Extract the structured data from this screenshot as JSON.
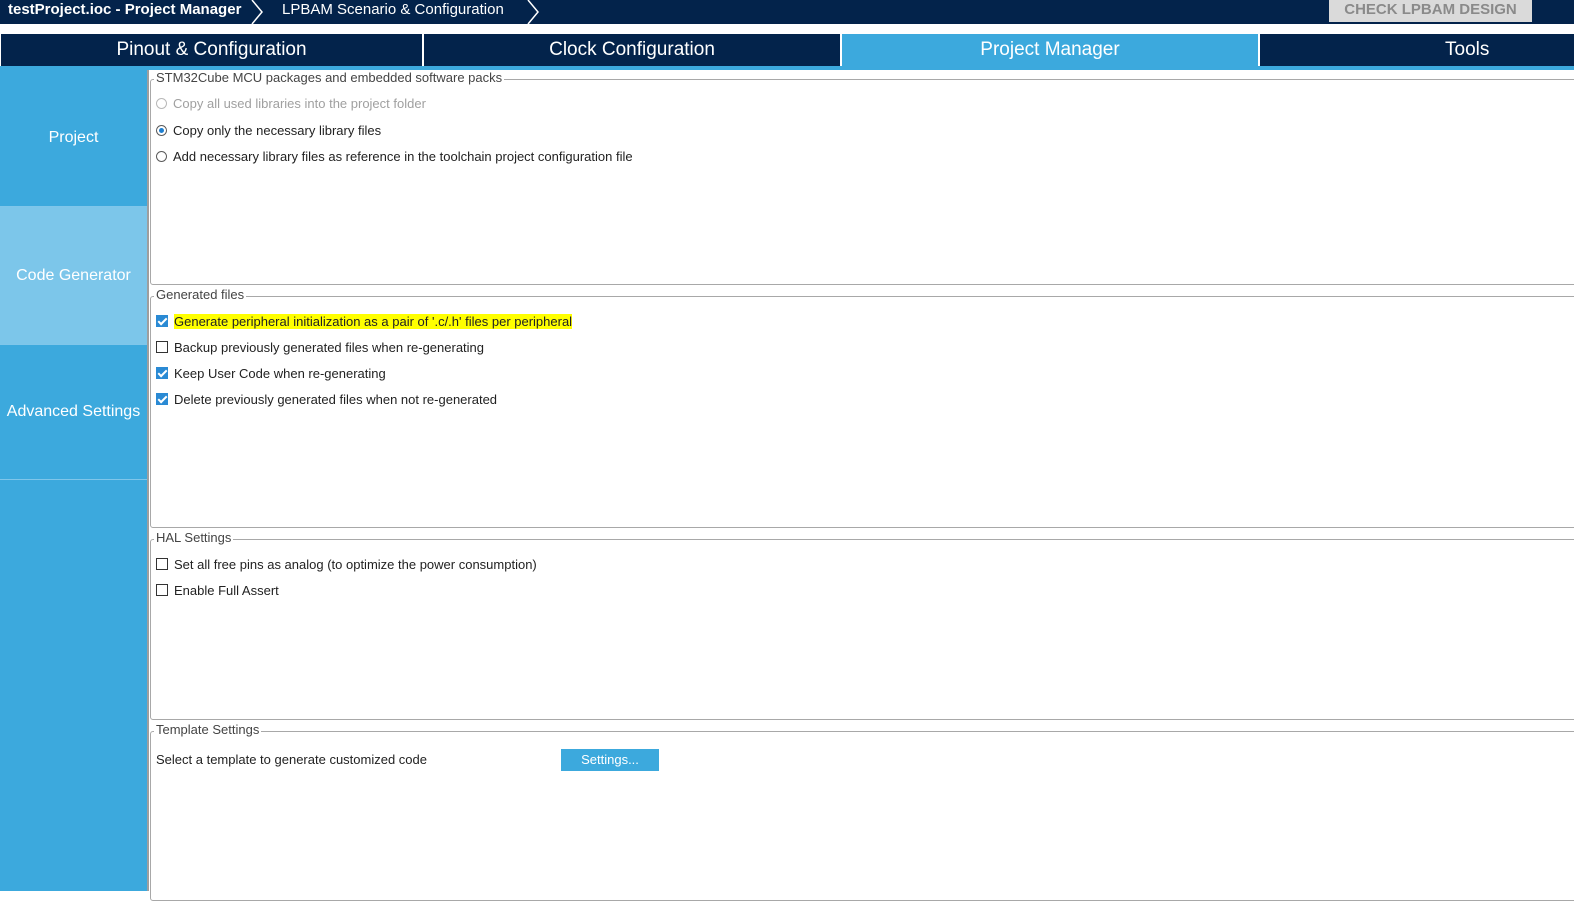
{
  "breadcrumb": {
    "items": [
      "testProject.ioc - Project Manager",
      "LPBAM Scenario & Configuration"
    ]
  },
  "top_button": "CHECK LPBAM DESIGN",
  "tabs": [
    {
      "label": "Pinout & Configuration",
      "active": false
    },
    {
      "label": "Clock Configuration",
      "active": false
    },
    {
      "label": "Project Manager",
      "active": true
    },
    {
      "label": "Tools",
      "active": false
    }
  ],
  "sidebar": {
    "items": [
      {
        "label": "Project",
        "active": false
      },
      {
        "label": "Code Generator",
        "active": true
      },
      {
        "label": "Advanced Settings",
        "active": false
      }
    ]
  },
  "packs_group": {
    "title": "STM32Cube MCU packages and embedded software packs",
    "options": [
      {
        "label": "Copy all used libraries into the project folder",
        "selected": false,
        "enabled": false
      },
      {
        "label": "Copy only the necessary library files",
        "selected": true,
        "enabled": true
      },
      {
        "label": "Add necessary library files as reference in the toolchain project configuration file",
        "selected": false,
        "enabled": true
      }
    ]
  },
  "generated_group": {
    "title": "Generated files",
    "options": [
      {
        "label": "Generate peripheral initialization as a pair of '.c/.h' files per peripheral",
        "checked": true,
        "highlighted": true
      },
      {
        "label": "Backup previously generated files when re-generating",
        "checked": false
      },
      {
        "label": "Keep User Code when re-generating",
        "checked": true
      },
      {
        "label": "Delete previously generated files when not re-generated",
        "checked": true
      }
    ]
  },
  "hal_group": {
    "title": "HAL Settings",
    "options": [
      {
        "label": "Set all free pins as analog (to optimize the power consumption)",
        "checked": false
      },
      {
        "label": "Enable Full Assert",
        "checked": false
      }
    ]
  },
  "template_group": {
    "title": "Template Settings",
    "label": "Select a template to generate customized code",
    "button": "Settings..."
  },
  "colors": {
    "navy": "#03234b",
    "accent": "#3ca9dd",
    "sidebar_active": "#7cc6ea",
    "highlight": "#ffff00"
  }
}
